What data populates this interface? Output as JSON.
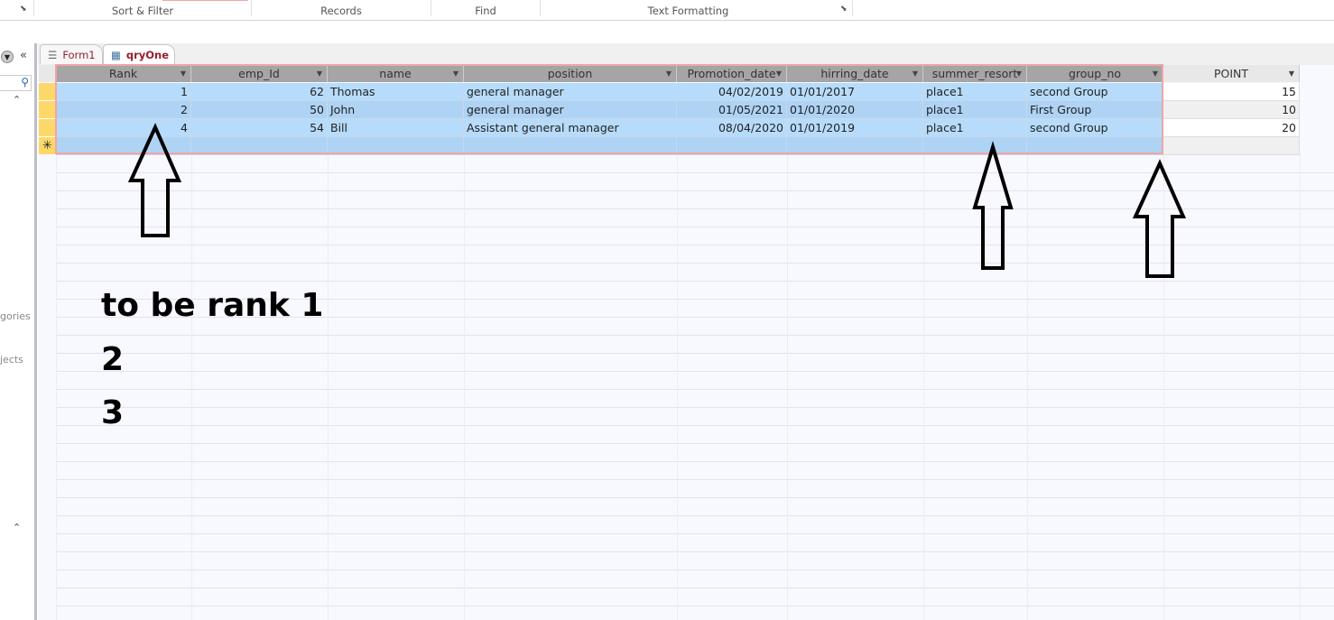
{
  "ribbon": {
    "groups": [
      "Sort & Filter",
      "Records",
      "Find",
      "Text Formatting"
    ]
  },
  "nav_pane": {
    "partial_labels": [
      "gories",
      "jects"
    ]
  },
  "tabs": [
    {
      "label": "Form1",
      "active": false
    },
    {
      "label": "qryOne",
      "active": true
    }
  ],
  "columns": [
    "Rank",
    "emp_Id",
    "name",
    "position",
    "Promotion_date",
    "hirring_date",
    "summer_resort",
    "group_no",
    "POINT"
  ],
  "rows": [
    [
      "1",
      "62",
      "Thomas",
      "general manager",
      "04/02/2019",
      "01/01/2017",
      "place1",
      "second Group",
      "15"
    ],
    [
      "2",
      "50",
      "John",
      "general manager",
      "01/05/2021",
      "01/01/2020",
      "place1",
      "First Group",
      "10"
    ],
    [
      "4",
      "54",
      "Bill",
      "Assistant general manager",
      "08/04/2020",
      "01/01/2019",
      "place1",
      "second Group",
      "20"
    ]
  ],
  "new_row_marker": "✳",
  "annotation": {
    "lines": [
      "to be rank 1",
      "2",
      "3"
    ]
  }
}
